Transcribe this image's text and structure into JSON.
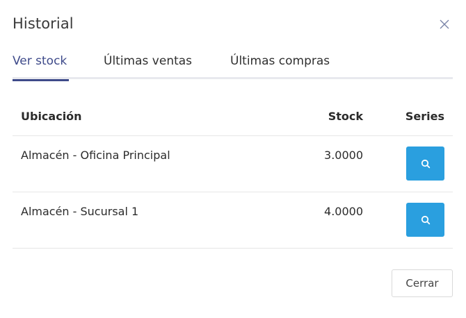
{
  "modal": {
    "title": "Historial",
    "close_icon": "close-icon"
  },
  "tabs": [
    {
      "label": "Ver stock",
      "active": true
    },
    {
      "label": "Últimas ventas",
      "active": false
    },
    {
      "label": "Últimas compras",
      "active": false
    }
  ],
  "table": {
    "headers": {
      "location": "Ubicación",
      "stock": "Stock",
      "series": "Series"
    },
    "rows": [
      {
        "location": "Almacén - Oficina Principal",
        "stock": "3.0000",
        "series_icon": "search-icon"
      },
      {
        "location": "Almacén - Sucursal 1",
        "stock": "4.0000",
        "series_icon": "search-icon"
      }
    ]
  },
  "footer": {
    "close_label": "Cerrar"
  },
  "colors": {
    "accent": "#3e4a8a",
    "button_blue": "#2a9fdf",
    "tab_underline": "#e8e9ee",
    "divider": "#e6e6e6"
  }
}
